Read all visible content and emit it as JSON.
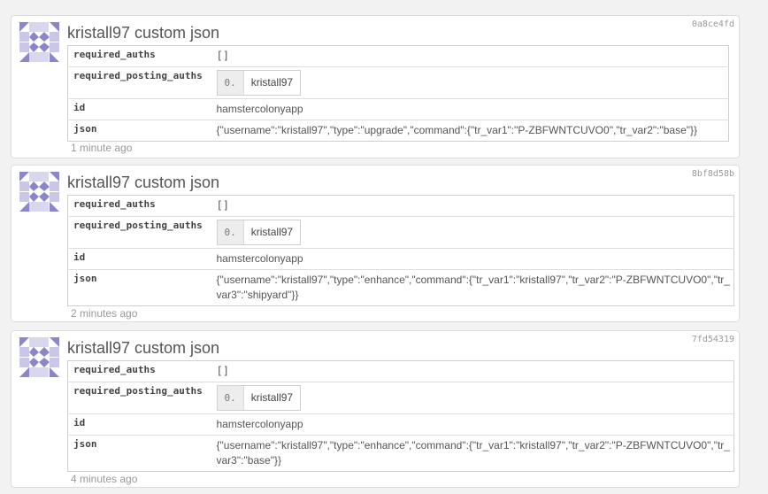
{
  "colors": {
    "page_bg": "#f2f2f2",
    "avatar_purple": "#8b86c9"
  },
  "cards": [
    {
      "hash": "0a8ce4fd",
      "title": "kristall97 custom json",
      "required_auths_label": "required_auths",
      "required_auths_value": "[]",
      "required_posting_auths_label": "required_posting_auths",
      "posting_auth_index": "0.",
      "posting_auth_value": "kristall97",
      "id_label": "id",
      "id_value": "hamstercolonyapp",
      "json_label": "json",
      "json_value": "{\"username\":\"kristall97\",\"type\":\"upgrade\",\"command\":{\"tr_var1\":\"P-ZBFWNTCUVO0\",\"tr_var2\":\"base\"}}",
      "time": "1 minute ago"
    },
    {
      "hash": "8bf8d58b",
      "title": "kristall97 custom json",
      "required_auths_label": "required_auths",
      "required_auths_value": "[]",
      "required_posting_auths_label": "required_posting_auths",
      "posting_auth_index": "0.",
      "posting_auth_value": "kristall97",
      "id_label": "id",
      "id_value": "hamstercolonyapp",
      "json_label": "json",
      "json_value": "{\"username\":\"kristall97\",\"type\":\"enhance\",\"command\":{\"tr_var1\":\"kristall97\",\"tr_var2\":\"P-ZBFWNTCUVO0\",\"tr_var3\":\"shipyard\"}}",
      "time": "2 minutes ago"
    },
    {
      "hash": "7fd54319",
      "title": "kristall97 custom json",
      "required_auths_label": "required_auths",
      "required_auths_value": "[]",
      "required_posting_auths_label": "required_posting_auths",
      "posting_auth_index": "0.",
      "posting_auth_value": "kristall97",
      "id_label": "id",
      "id_value": "hamstercolonyapp",
      "json_label": "json",
      "json_value": "{\"username\":\"kristall97\",\"type\":\"enhance\",\"command\":{\"tr_var1\":\"kristall97\",\"tr_var2\":\"P-ZBFWNTCUVO0\",\"tr_var3\":\"base\"}}",
      "time": "4 minutes ago"
    }
  ]
}
